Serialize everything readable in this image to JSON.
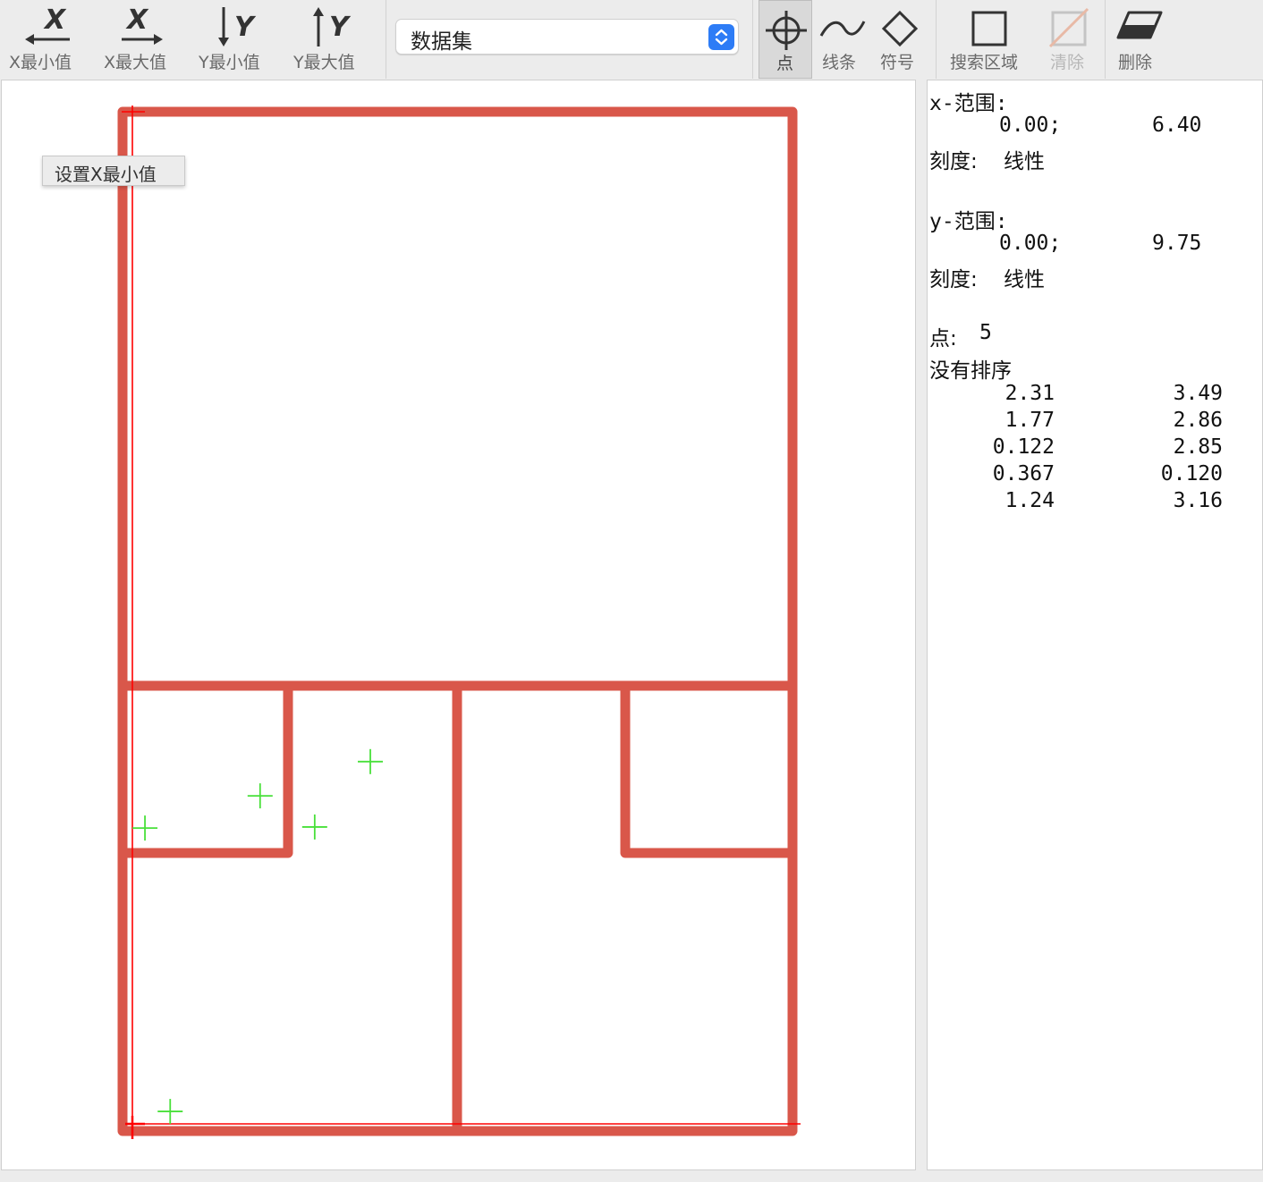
{
  "toolbar": {
    "x_min_label": "X最小值",
    "x_max_label": "X最大值",
    "y_min_label": "Y最小值",
    "y_max_label": "Y最大值",
    "point_label": "点",
    "line_label": "线条",
    "symbol_label": "符号",
    "search_area_label": "搜索区域",
    "clear_label": "清除",
    "delete_label": "删除",
    "axis_x_glyph": "X",
    "axis_y_glyph": "Y"
  },
  "dataset_select": {
    "value": "数据集"
  },
  "tooltip": {
    "text": "设置X最小值"
  },
  "info": {
    "x_range_label": "x-范围:",
    "x_min": "0.00;",
    "x_max": "6.40",
    "x_scale_label": "刻度:",
    "x_scale_value": "线性",
    "y_range_label": "y-范围:",
    "y_min": "0.00;",
    "y_max": "9.75",
    "y_scale_label": "刻度:",
    "y_scale_value": "线性",
    "points_label": "点:",
    "points_count": "5",
    "sort_label": "没有排序",
    "points": [
      {
        "x": "2.31",
        "y": "3.49"
      },
      {
        "x": "1.77",
        "y": "2.86"
      },
      {
        "x": "0.122",
        "y": "2.85"
      },
      {
        "x": "0.367",
        "y": "0.120"
      },
      {
        "x": "1.24",
        "y": "3.16"
      }
    ]
  },
  "plot": {
    "x_range": [
      0.0,
      6.4
    ],
    "y_range": [
      0.0,
      9.75
    ],
    "marker_color": "#49e03a",
    "wall_color": "#d9574a",
    "axis_line_color": "#ff0000"
  },
  "colors": {
    "toolbar_bg": "#ececec",
    "accent_blue": "#2d7cf6",
    "label_gray": "#6a6a6a"
  }
}
